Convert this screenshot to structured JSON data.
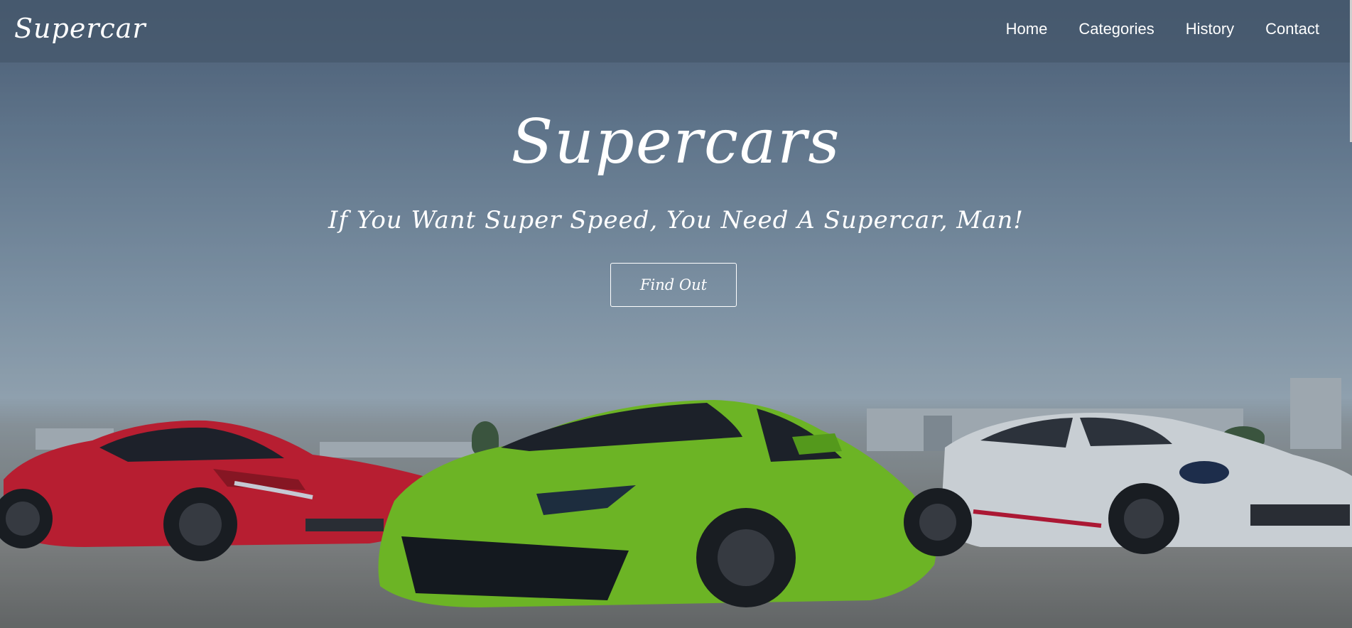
{
  "nav": {
    "brand": "Supercar",
    "links": [
      "Home",
      "Categories",
      "History",
      "Contact"
    ]
  },
  "hero": {
    "title": "Supercars",
    "subtitle": "If You Want Super Speed, You Need A Supercar, Man!",
    "cta_label": "Find Out"
  },
  "colors": {
    "car_red": "#d7182a",
    "car_green": "#7ccf1b",
    "car_white": "#eceeef",
    "text": "#ffffff"
  }
}
